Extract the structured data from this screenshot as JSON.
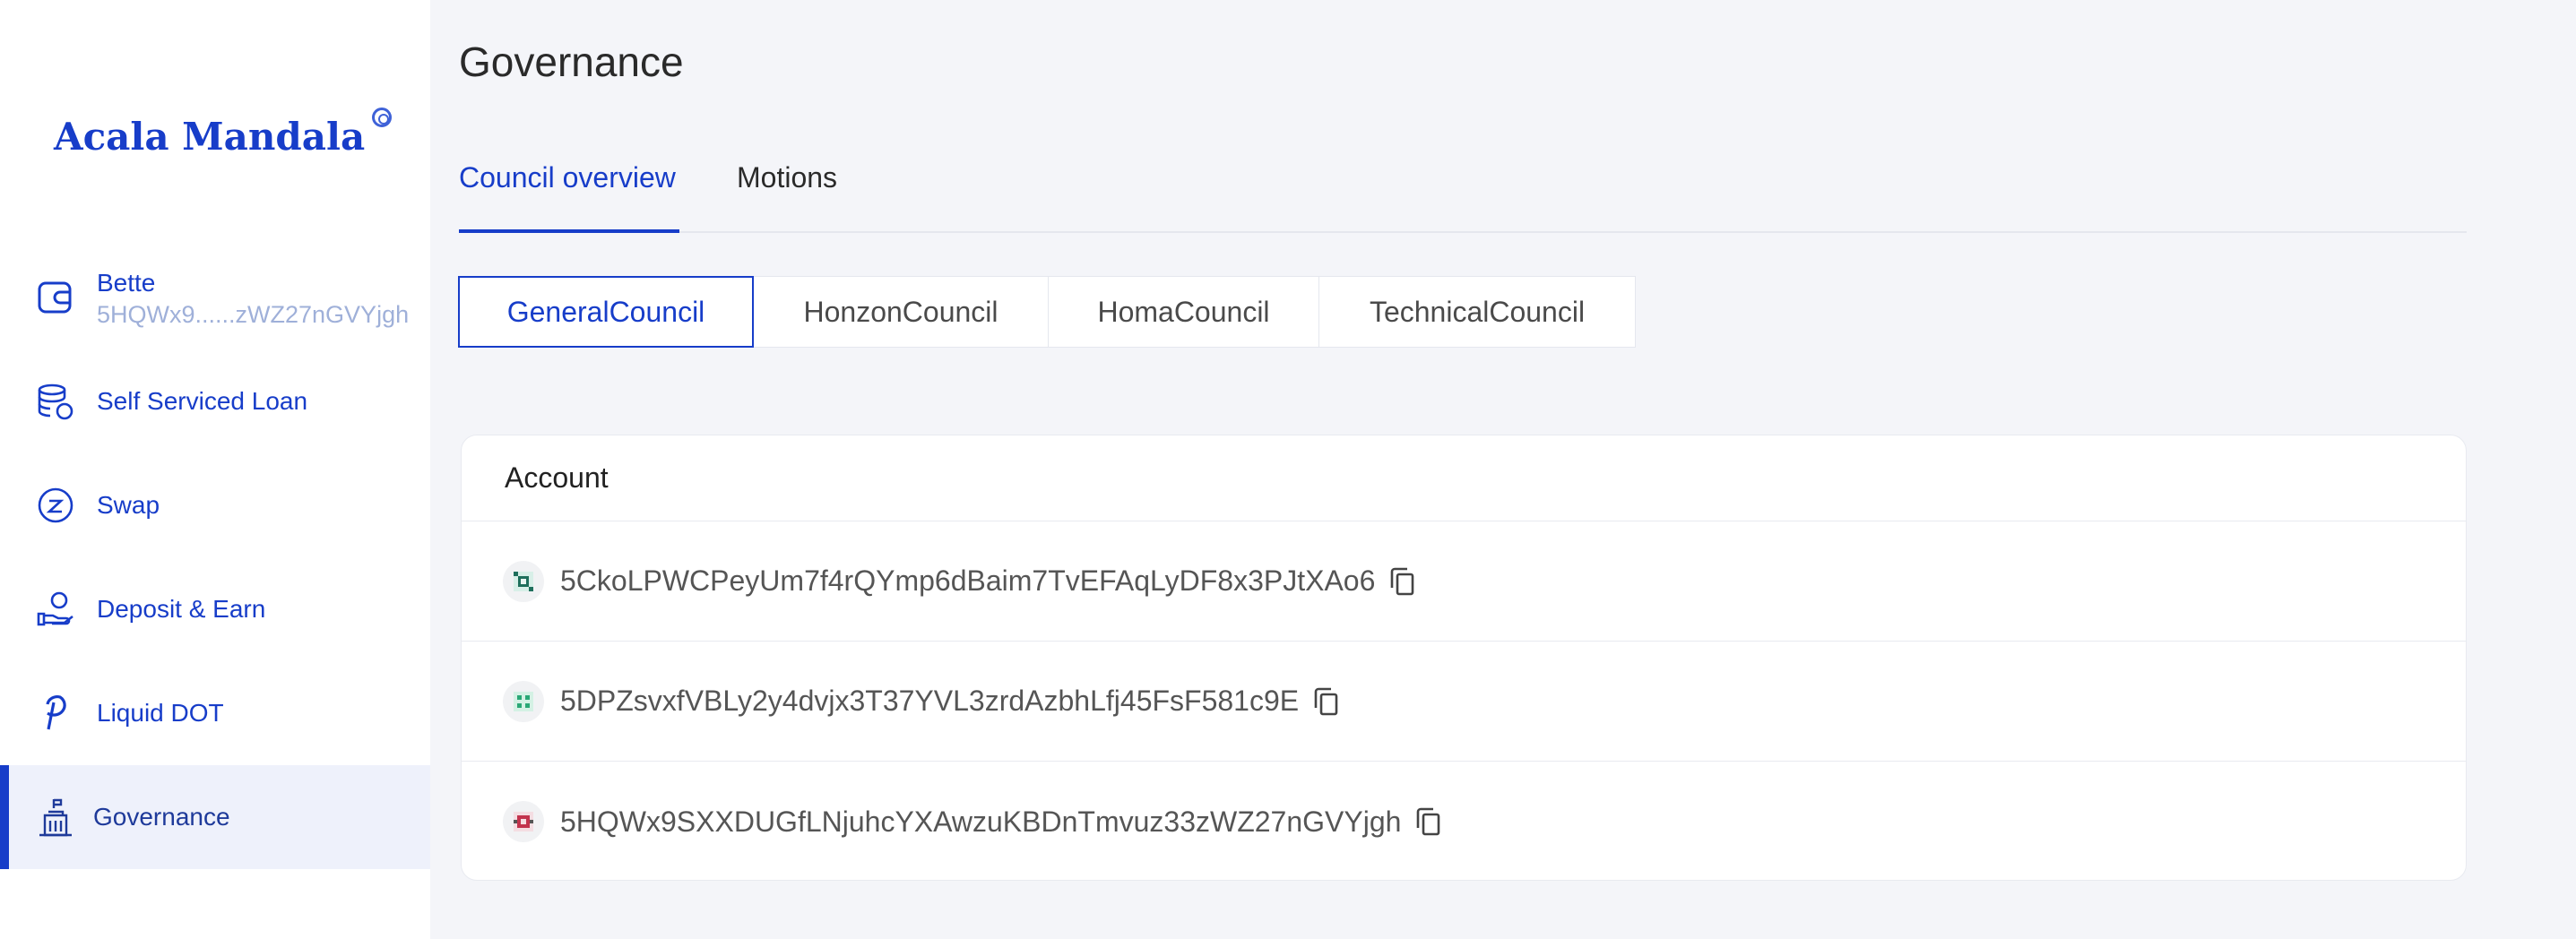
{
  "sidebar": {
    "logo": "Acala Mandala",
    "account": {
      "name": "Bette",
      "address": "5HQWx9......zWZ27nGVYjgh"
    },
    "items": [
      {
        "label": "Self Serviced Loan",
        "icon": "loan-coin-icon"
      },
      {
        "label": "Swap",
        "icon": "swap-icon"
      },
      {
        "label": "Deposit & Earn",
        "icon": "deposit-hand-icon"
      },
      {
        "label": "Liquid DOT",
        "icon": "polkadot-icon"
      },
      {
        "label": "Governance",
        "icon": "governance-building-icon",
        "active": true
      }
    ]
  },
  "main": {
    "title": "Governance",
    "tabs": [
      {
        "label": "Council overview",
        "active": true
      },
      {
        "label": "Motions",
        "active": false
      }
    ],
    "councils": [
      {
        "label": "GeneralCouncil",
        "active": true
      },
      {
        "label": "HonzonCouncil",
        "active": false
      },
      {
        "label": "HomaCouncil",
        "active": false
      },
      {
        "label": "TechnicalCouncil",
        "active": false
      }
    ],
    "table": {
      "header": "Account",
      "rows": [
        {
          "address": "5CkoLPWCPeyUm7f4rQYmp6dBaim7TvEFAqLyDF8x3PJtXAo6",
          "icon_color": "#1f6f5c"
        },
        {
          "address": "5DPZsvxfVBLy2y4dvjx3T37YVL3zrdAzbhLfj45FsF581c9E",
          "icon_color": "#2aa876"
        },
        {
          "address": "5HQWx9SXXDUGfLNjuhcYXAwzuKBDnTmvuz33zWZ27nGVYjgh",
          "icon_color": "#c2334d"
        }
      ]
    }
  },
  "colors": {
    "brand": "#173dc9",
    "background": "#f4f5f9"
  }
}
